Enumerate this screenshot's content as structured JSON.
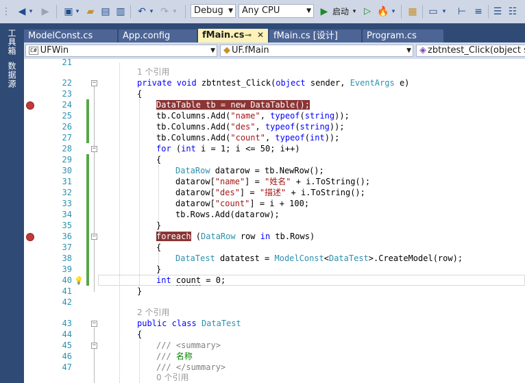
{
  "toolbar": {
    "config": "Debug",
    "platform": "Any CPU",
    "start_label": "启动"
  },
  "side_tabs": [
    "工具箱",
    "数据源"
  ],
  "tabs": [
    {
      "label": "ModelConst.cs"
    },
    {
      "label": "App.config"
    },
    {
      "label": "fMain.cs",
      "active": true
    },
    {
      "label": "fMain.cs [设计]"
    },
    {
      "label": "Program.cs"
    }
  ],
  "nav": {
    "project": "UFWin",
    "class": "UF.fMain",
    "member": "zbtntest_Click(object sender"
  },
  "editor": {
    "current_line": 40,
    "ref_counts": {
      "method": "1 个引用",
      "class": "2 个引用",
      "member": "0 个引用"
    },
    "line_numbers": [
      "21",
      "22",
      "23",
      "24",
      "25",
      "26",
      "27",
      "28",
      "29",
      "30",
      "31",
      "32",
      "33",
      "34",
      "35",
      "36",
      "37",
      "38",
      "39",
      "40",
      "41",
      "42",
      "43",
      "44",
      "45",
      "46",
      "47"
    ],
    "breakpoint_lines": [
      24,
      36
    ],
    "code": {
      "l22_a": "private void",
      "l22_b": " zbtntest_Click(",
      "l22_c": "object",
      "l22_d": " sender, ",
      "l22_e": "EventArgs",
      "l22_f": " e)",
      "l23": "{",
      "l24_a": "DataTable",
      "l24_b": " tb = ",
      "l24_c": "new",
      "l24_d": " DataTable();",
      "l25_a": "tb.Columns.Add(",
      "l25_b": "\"name\"",
      "l25_c": ", ",
      "l25_d": "typeof",
      "l25_e": "(",
      "l25_f": "string",
      "l25_g": "));",
      "l26_a": "tb.Columns.Add(",
      "l26_b": "\"des\"",
      "l26_c": ", ",
      "l26_d": "typeof",
      "l26_e": "(",
      "l26_f": "string",
      "l26_g": "));",
      "l27_a": "tb.Columns.Add(",
      "l27_b": "\"count\"",
      "l27_c": ", ",
      "l27_d": "typeof",
      "l27_e": "(",
      "l27_f": "int",
      "l27_g": "));",
      "l28_a": "for",
      "l28_b": " (",
      "l28_c": "int",
      "l28_d": " i = 1; i <= 50; i++)",
      "l29": "{",
      "l30_a": "DataRow",
      "l30_b": " datarow = tb.NewRow();",
      "l31_a": "datarow[",
      "l31_b": "\"name\"",
      "l31_c": "] = ",
      "l31_d": "\"姓名\"",
      "l31_e": " + i.ToString();",
      "l32_a": "datarow[",
      "l32_b": "\"des\"",
      "l32_c": "] = ",
      "l32_d": "\"描述\"",
      "l32_e": " + i.ToString();",
      "l33_a": "datarow[",
      "l33_b": "\"count\"",
      "l33_c": "] = i + 100;",
      "l34": "tb.Rows.Add(datarow);",
      "l35": "}",
      "l36_a": "foreach",
      "l36_b": " (",
      "l36_c": "DataRow",
      "l36_d": " row ",
      "l36_e": "in",
      "l36_f": " tb.Rows)",
      "l37": "{",
      "l38_a": "DataTest",
      "l38_b": " datatest = ",
      "l38_c": "ModelConst",
      "l38_d": "<",
      "l38_e": "DataTest",
      "l38_f": ">.CreateModel(row);",
      "l39": "}",
      "l40_a": "int",
      "l40_b": "count",
      "l40_c": " = 0;",
      "l41": "}",
      "l43_a": "public class",
      "l43_b": "DataTest",
      "l44": "{",
      "l45_a": "/// ",
      "l45_b": "<summary>",
      "l46_a": "/// ",
      "l46_b": "名称",
      "l47_a": "/// ",
      "l47_b": "</summary>"
    }
  }
}
